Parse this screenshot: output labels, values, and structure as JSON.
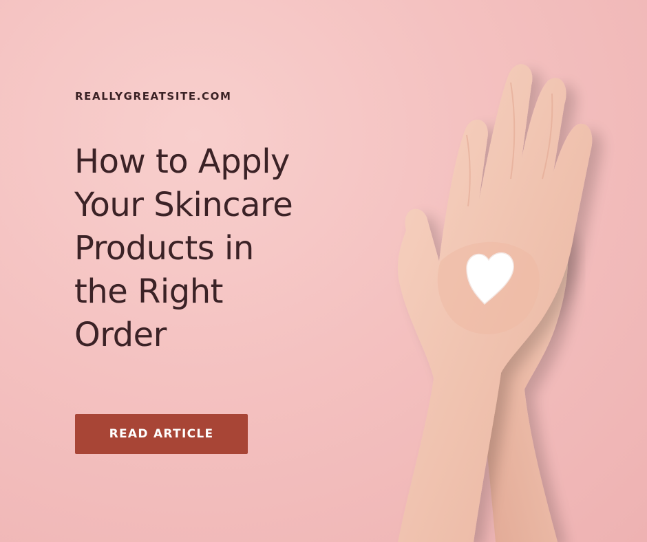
{
  "site": {
    "url_label": "REALLYGREATSITE.COM"
  },
  "headline": {
    "lines": [
      "How to Apply",
      "Your Skincare",
      "Products in",
      "the Right",
      "Order"
    ]
  },
  "cta": {
    "label": "READ ARTICLE"
  },
  "colors": {
    "background": "#f4c1c0",
    "text": "#3b2226",
    "button": "#a84536",
    "button_text": "#ffffff",
    "skin": "#f2c6b2",
    "cream": "#ffffff"
  },
  "image": {
    "subject_icon": "hands-holding-heart-cream-icon"
  }
}
